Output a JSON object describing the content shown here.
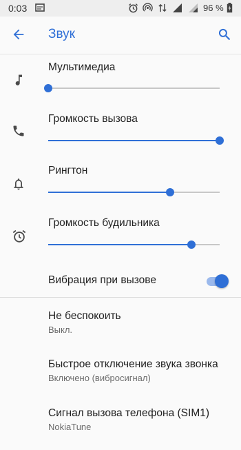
{
  "status_bar": {
    "time": "0:03",
    "battery_percent": "96 %",
    "icons": [
      "notification-icon",
      "alarm-icon",
      "hotspot-icon",
      "data-transfer-icon",
      "signal-icon",
      "signal-icon",
      "battery-icon"
    ]
  },
  "app_bar": {
    "title": "Звук",
    "back_icon": "arrow-back-icon",
    "search_icon": "search-icon"
  },
  "volumes": [
    {
      "label": "Мультимедиа",
      "icon": "music-note-icon",
      "level": 0.0
    },
    {
      "label": "Громкость вызова",
      "icon": "phone-icon",
      "level": 1.0
    },
    {
      "label": "Рингтон",
      "icon": "bell-icon",
      "level": 0.71
    },
    {
      "label": "Громкость будильника",
      "icon": "alarm-clock-icon",
      "level": 0.835
    }
  ],
  "vibration": {
    "label": "Вибрация при вызове",
    "checked": true
  },
  "prefs": [
    {
      "title": "Не беспокоить",
      "summary": "Выкл."
    },
    {
      "title": "Быстрое отключение звука звонка",
      "summary": "Включено (вибросигнал)"
    },
    {
      "title": "Сигнал вызова телефона (SIM1)",
      "summary": "NokiaTune"
    }
  ],
  "colors": {
    "accent": "#2f6fd6",
    "track_inactive": "#c7c7c7",
    "switch_track": "#9bb9ec"
  }
}
